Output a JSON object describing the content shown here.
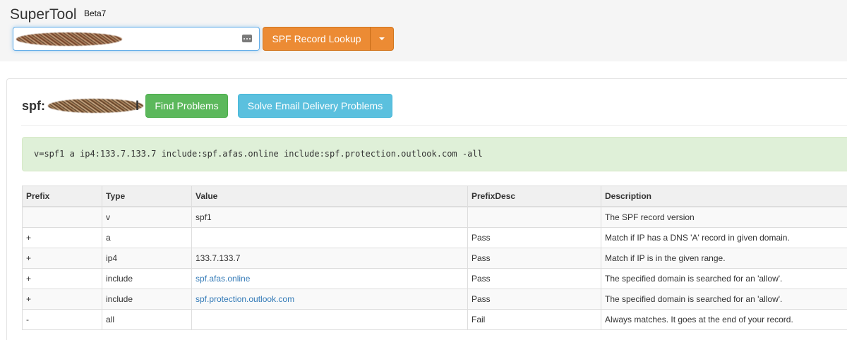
{
  "header": {
    "app_title": "SuperTool",
    "beta_label": "Beta7",
    "search": {
      "value": "",
      "placeholder": ""
    },
    "lookup_button_label": "SPF Record Lookup",
    "dropdown_icon": "caret-down-icon",
    "autofill_icon": "autofill-dots-icon"
  },
  "result": {
    "title_prefix": "spf:",
    "title_suffix": "l",
    "find_button_label": "Find Problems",
    "solve_button_label": "Solve Email Delivery Problems",
    "spf_record": "v=spf1 a ip4:133.7.133.7 include:spf.afas.online include:spf.protection.outlook.com -all"
  },
  "table": {
    "columns": [
      "Prefix",
      "Type",
      "Value",
      "PrefixDesc",
      "Description"
    ],
    "rows": [
      {
        "prefix": "",
        "type": "v",
        "value": "spf1",
        "value_link": false,
        "prefix_desc": "",
        "description": "The SPF record version"
      },
      {
        "prefix": "+",
        "type": "a",
        "value": "",
        "value_link": false,
        "prefix_desc": "Pass",
        "description": "Match if IP has a DNS 'A' record in given domain."
      },
      {
        "prefix": "+",
        "type": "ip4",
        "value": "133.7.133.7",
        "value_link": false,
        "prefix_desc": "Pass",
        "description": "Match if IP is in the given range."
      },
      {
        "prefix": "+",
        "type": "include",
        "value": "spf.afas.online",
        "value_link": true,
        "prefix_desc": "Pass",
        "description": "The specified domain is searched for an 'allow'."
      },
      {
        "prefix": "+",
        "type": "include",
        "value": "spf.protection.outlook.com",
        "value_link": true,
        "prefix_desc": "Pass",
        "description": "The specified domain is searched for an 'allow'."
      },
      {
        "prefix": "-",
        "type": "all",
        "value": "",
        "value_link": false,
        "prefix_desc": "Fail",
        "description": "Always matches. It goes at the end of your record."
      }
    ]
  },
  "colors": {
    "lookup_button": "#ec8b34",
    "find_button": "#5cb85c",
    "solve_button": "#5bc0de",
    "record_box": "#dff0d8",
    "link": "#337ab7"
  }
}
